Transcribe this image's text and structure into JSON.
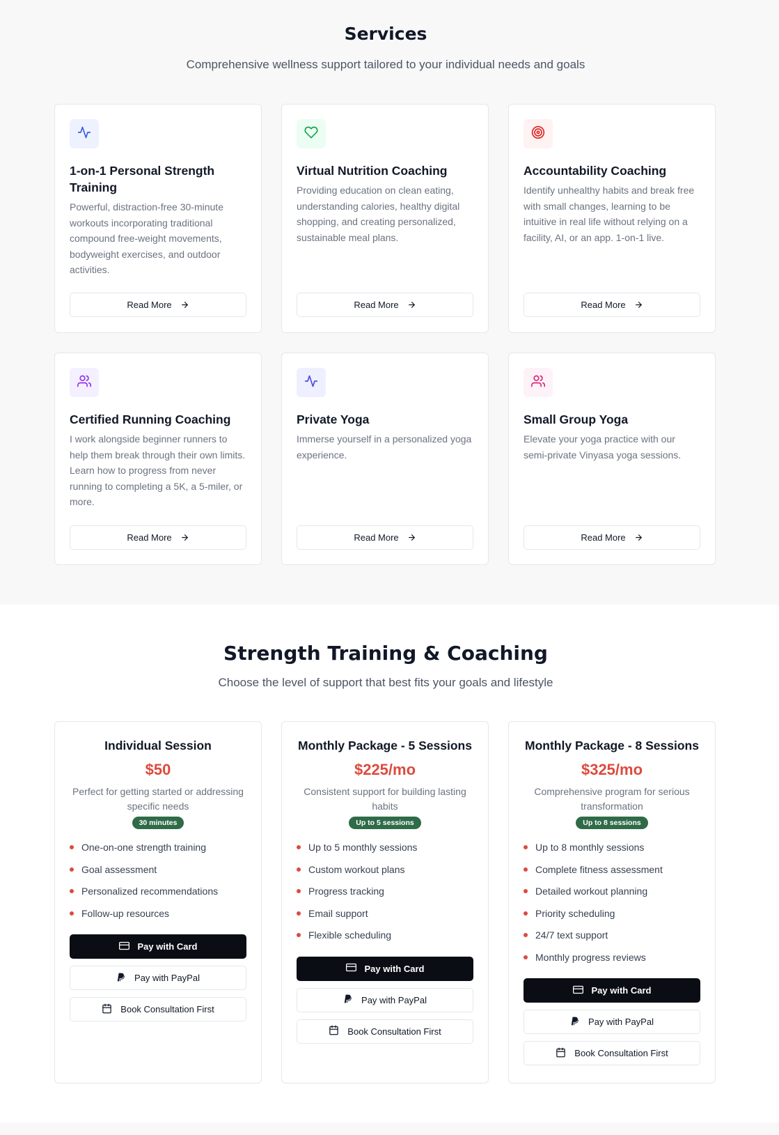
{
  "services": {
    "title": "Services",
    "subtitle": "Comprehensive wellness support tailored to your individual needs and goals",
    "cards": [
      {
        "title": "1-on-1 Personal Strength Training",
        "description": "Powerful, distraction-free 30-minute workouts incorporating traditional compound free-weight movements, bodyweight exercises, and outdoor activities.",
        "button": "Read More",
        "icon": "activity-icon",
        "icon_color": "#3b5bdb",
        "icon_bg": "#eef2ff"
      },
      {
        "title": "Virtual Nutrition Coaching",
        "description": "Providing education on clean eating, understanding calories, healthy digital shopping, and creating personalized, sustainable meal plans.",
        "button": "Read More",
        "icon": "heart-icon",
        "icon_color": "#16a34a",
        "icon_bg": "#ecfdf3"
      },
      {
        "title": "Accountability Coaching",
        "description": "Identify unhealthy habits and break free with small changes, learning to be intuitive in real life without relying on a facility, AI, or an app. 1-on-1 live.",
        "button": "Read More",
        "icon": "target-icon",
        "icon_color": "#dc2626",
        "icon_bg": "#fef2f2"
      },
      {
        "title": "Certified Running Coaching",
        "description": "I work alongside beginner runners to help them break through their own limits. Learn how to progress from never running to completing a 5K, a 5-miler, or more.",
        "button": "Read More",
        "icon": "users-icon",
        "icon_color": "#9333ea",
        "icon_bg": "#f5f0ff"
      },
      {
        "title": "Private Yoga",
        "description": "Immerse yourself in a personalized yoga experience.",
        "button": "Read More",
        "icon": "activity-icon",
        "icon_color": "#4f46e5",
        "icon_bg": "#eef0ff"
      },
      {
        "title": "Small Group Yoga",
        "description": "Elevate your yoga practice with our semi-private Vinyasa yoga sessions.",
        "button": "Read More",
        "icon": "users-icon",
        "icon_color": "#db2777",
        "icon_bg": "#fdf2f8"
      }
    ]
  },
  "pricing": {
    "title": "Strength Training & Coaching",
    "subtitle": "Choose the level of support that best fits your goals and lifestyle",
    "plans": [
      {
        "name": "Individual Session",
        "price": "$50",
        "description": "Perfect for getting started or addressing specific needs",
        "badge": "30 minutes",
        "features": [
          "One-on-one strength training",
          "Goal assessment",
          "Personalized recommendations",
          "Follow-up resources"
        ],
        "pay_card": "Pay with Card",
        "pay_paypal": "Pay with PayPal",
        "consult": "Book Consultation First"
      },
      {
        "name": "Monthly Package - 5 Sessions",
        "price": "$225/mo",
        "description": "Consistent support for building lasting habits",
        "badge": "Up to 5 sessions",
        "features": [
          "Up to 5 monthly sessions",
          "Custom workout plans",
          "Progress tracking",
          "Email support",
          "Flexible scheduling"
        ],
        "pay_card": "Pay with Card",
        "pay_paypal": "Pay with PayPal",
        "consult": "Book Consultation First"
      },
      {
        "name": "Monthly Package - 8 Sessions",
        "price": "$325/mo",
        "description": "Comprehensive program for serious transformation",
        "badge": "Up to 8 sessions",
        "features": [
          "Up to 8 monthly sessions",
          "Complete fitness assessment",
          "Detailed workout planning",
          "Priority scheduling",
          "24/7 text support",
          "Monthly progress reviews"
        ],
        "pay_card": "Pay with Card",
        "pay_paypal": "Pay with PayPal",
        "consult": "Book Consultation First"
      }
    ]
  },
  "colors": {
    "accent": "#dc4b3e",
    "badge": "#2f6b47",
    "dark_button": "#0b0d14"
  }
}
